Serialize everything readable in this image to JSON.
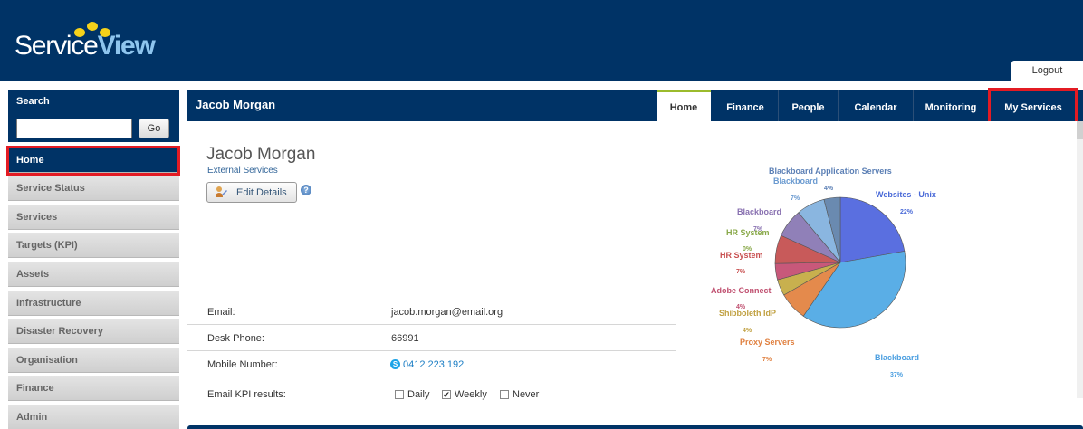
{
  "header": {
    "logo_text_1": "Service",
    "logo_text_2": "View",
    "logout_label": "Logout"
  },
  "sidebar": {
    "search_title": "Search",
    "search_value": "",
    "go_label": "Go",
    "items": [
      {
        "label": "Home",
        "active": true
      },
      {
        "label": "Service Status"
      },
      {
        "label": "Services"
      },
      {
        "label": "Targets (KPI)"
      },
      {
        "label": "Assets"
      },
      {
        "label": "Infrastructure"
      },
      {
        "label": "Disaster Recovery"
      },
      {
        "label": "Organisation"
      },
      {
        "label": "Finance"
      },
      {
        "label": "Admin"
      }
    ]
  },
  "main": {
    "panel_title": "Jacob Morgan",
    "tabs": [
      {
        "label": "Home",
        "active": true
      },
      {
        "label": "Finance"
      },
      {
        "label": "People"
      },
      {
        "label": "Calendar"
      },
      {
        "label": "Monitoring"
      },
      {
        "label": "My Services"
      }
    ]
  },
  "profile": {
    "name": "Jacob Morgan",
    "subtitle": "External Services",
    "edit_label": "Edit Details",
    "help_glyph": "?",
    "fields": [
      {
        "label": "Email:",
        "value": "jacob.morgan@email.org"
      },
      {
        "label": "Desk Phone:",
        "value": "66991"
      },
      {
        "label": "Mobile Number:",
        "value": "0412 223 192"
      }
    ],
    "kpi": {
      "label": "Email KPI results:",
      "options": [
        {
          "label": "Daily",
          "checked": false
        },
        {
          "label": "Weekly",
          "checked": true
        },
        {
          "label": "Never",
          "checked": false
        }
      ]
    }
  },
  "chart_data": {
    "type": "pie",
    "slices": [
      {
        "label": "Websites - Unix",
        "pct": "22%",
        "value": 22,
        "color": "#5a6fe0"
      },
      {
        "label": "Blackboard",
        "pct": "37%",
        "value": 37,
        "color": "#5aaee6"
      },
      {
        "label": "Proxy Servers",
        "pct": "7%",
        "value": 7,
        "color": "#e48a4c"
      },
      {
        "label": "Shibboleth IdP",
        "pct": "4%",
        "value": 4,
        "color": "#c8b04e"
      },
      {
        "label": "Adobe Connect",
        "pct": "4%",
        "value": 4,
        "color": "#c8587a"
      },
      {
        "label": "HR System",
        "pct": "7%",
        "value": 7,
        "color": "#c85a5a"
      },
      {
        "label": "HR System",
        "pct": "0%",
        "value": 0,
        "color": "#8aa84a"
      },
      {
        "label": "Blackboard",
        "pct": "7%",
        "value": 7,
        "color": "#9080b8"
      },
      {
        "label": "Blackboard",
        "pct": "7%",
        "value": 7,
        "color": "#8ab6e0"
      },
      {
        "label": "Blackboard Application Servers",
        "pct": "4%",
        "value": 4,
        "color": "#6a8ab0"
      }
    ]
  }
}
